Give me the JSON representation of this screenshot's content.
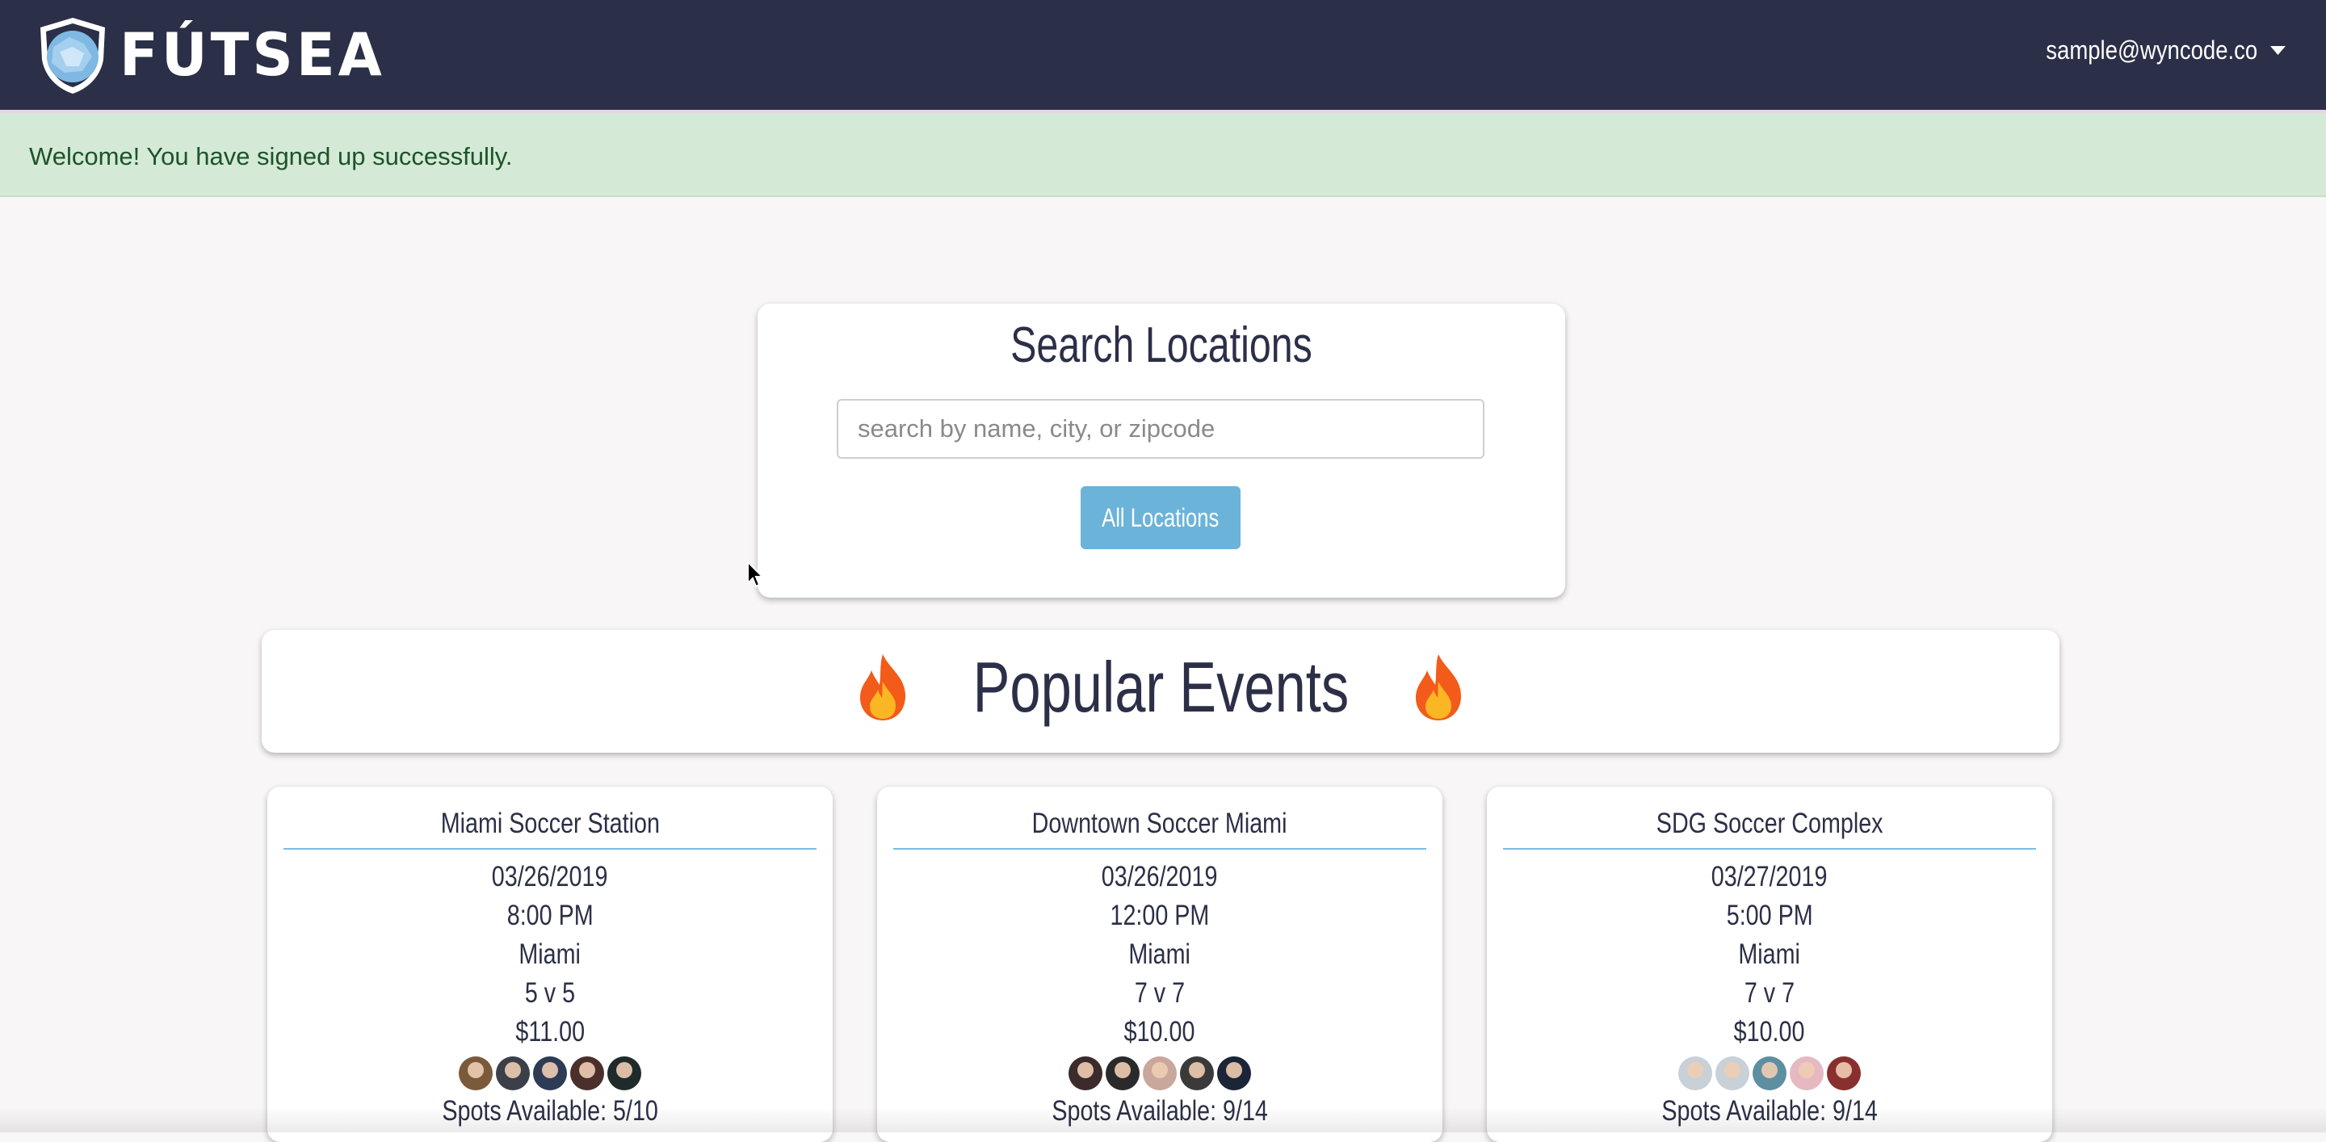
{
  "header": {
    "brand": "FÚTSEA",
    "user_email": "sample@wyncode.co"
  },
  "alert": {
    "message": "Welcome! You have signed up successfully."
  },
  "search": {
    "title": "Search Locations",
    "placeholder": "search by name, city, or zipcode",
    "value": "",
    "button_label": "All Locations"
  },
  "popular": {
    "title": "Popular Events"
  },
  "events": [
    {
      "name": "Miami Soccer Station",
      "date": "03/26/2019",
      "time": "8:00 PM",
      "city": "Miami",
      "format": "5 v 5",
      "price": "$11.00",
      "spots": "Spots Available: 5/10"
    },
    {
      "name": "Downtown Soccer Miami",
      "date": "03/26/2019",
      "time": "12:00 PM",
      "city": "Miami",
      "format": "7 v 7",
      "price": "$10.00",
      "spots": "Spots Available: 9/14"
    },
    {
      "name": "SDG Soccer Complex",
      "date": "03/27/2019",
      "time": "5:00 PM",
      "city": "Miami",
      "format": "7 v 7",
      "price": "$10.00",
      "spots": "Spots Available: 9/14"
    }
  ],
  "icons": {
    "brand": "shield-globe-icon",
    "popular": "fire-icon",
    "menu": "caret-down-icon"
  },
  "colors": {
    "navbar": "#2b2f47",
    "alert_bg": "#d5e9d7",
    "alert_text": "#1c5429",
    "button": "#6bb3d8",
    "divider": "#7fbbe0"
  }
}
